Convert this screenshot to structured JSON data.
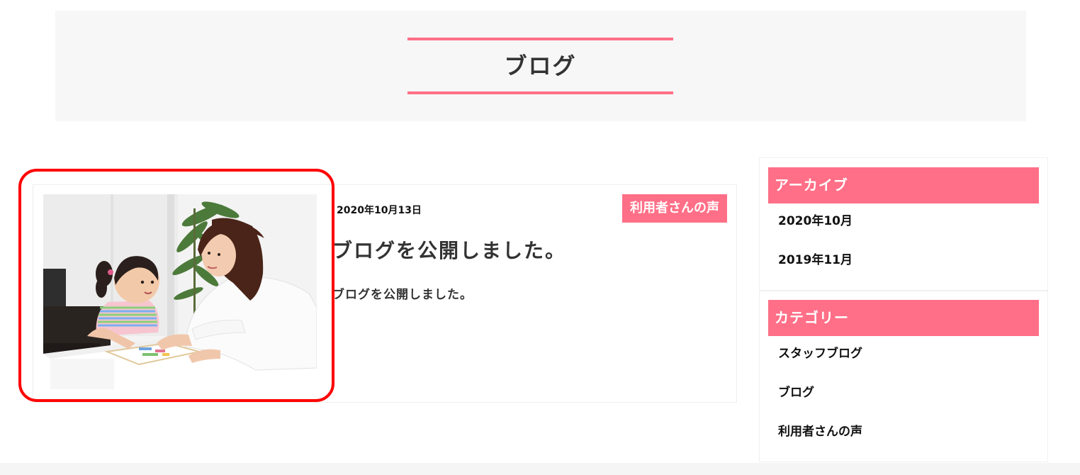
{
  "header": {
    "title": "ブログ"
  },
  "post": {
    "date": "2020年10月13日",
    "category": "利用者さんの声",
    "title": "ブログを公開しました。",
    "excerpt": "ブログを公開しました。",
    "thumbnail_icon": "teacher-and-child-photo"
  },
  "sidebar": {
    "archive": {
      "title": "アーカイブ",
      "items": [
        "2020年10月",
        "2019年11月"
      ]
    },
    "category": {
      "title": "カテゴリー",
      "items": [
        "スタッフブログ",
        "ブログ",
        "利用者さんの声"
      ]
    }
  },
  "colors": {
    "accent": "#ff6f87",
    "highlight": "#ff0000",
    "header_bg": "#f7f7f7"
  }
}
